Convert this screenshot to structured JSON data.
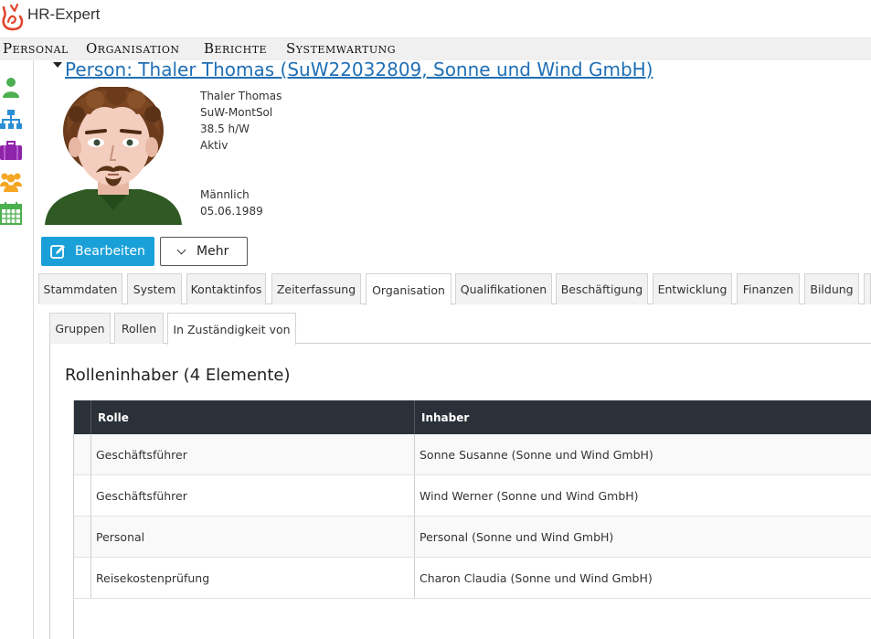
{
  "app": {
    "title": "HR-Expert",
    "brand_color": "#e2452b"
  },
  "menu": {
    "items": [
      {
        "label": "Personal"
      },
      {
        "label": "Organisation"
      },
      {
        "label": "Berichte"
      },
      {
        "label": "Systemwartung"
      }
    ]
  },
  "sidebar": {
    "icons": [
      {
        "name": "person-icon",
        "color": "#4caf50"
      },
      {
        "name": "org-chart-icon",
        "color": "#2a8fd4"
      },
      {
        "name": "briefcase-icon",
        "color": "#8e24aa"
      },
      {
        "name": "group-icon",
        "color": "#f5a623"
      },
      {
        "name": "calendar-icon",
        "color": "#4caf50"
      }
    ]
  },
  "person": {
    "title": "Person: Thaler Thomas (SuW22032809, Sonne und Wind GmbH)",
    "name": "Thaler Thomas",
    "unit": "SuW-MontSol",
    "hours": "38.5 h/W",
    "status": "Aktiv",
    "gender": "Männlich",
    "birthdate": "05.06.1989"
  },
  "actions": {
    "edit_label": "Bearbeiten",
    "more_label": "Mehr"
  },
  "tabs": [
    {
      "label": "Stammdaten"
    },
    {
      "label": "System"
    },
    {
      "label": "Kontaktinfos"
    },
    {
      "label": "Zeiterfassung"
    },
    {
      "label": "Organisation",
      "active": true
    },
    {
      "label": "Qualifikationen"
    },
    {
      "label": "Beschäftigung"
    },
    {
      "label": "Entwicklung"
    },
    {
      "label": "Finanzen"
    },
    {
      "label": "Bildung"
    }
  ],
  "subtabs": [
    {
      "label": "Gruppen"
    },
    {
      "label": "Rollen"
    },
    {
      "label": "In Zuständigkeit von",
      "active": true
    }
  ],
  "section": {
    "title": "Rolleninhaber (4 Elemente)"
  },
  "table": {
    "columns": [
      "Rolle",
      "Inhaber"
    ],
    "rows": [
      {
        "rolle": "Geschäftsführer",
        "inhaber": "Sonne Susanne (Sonne und Wind GmbH)"
      },
      {
        "rolle": "Geschäftsführer",
        "inhaber": "Wind Werner (Sonne und Wind GmbH)"
      },
      {
        "rolle": "Personal",
        "inhaber": "Personal (Sonne und Wind GmbH)"
      },
      {
        "rolle": "Reisekostenprüfung",
        "inhaber": "Charon Claudia (Sonne und Wind GmbH)"
      }
    ]
  }
}
